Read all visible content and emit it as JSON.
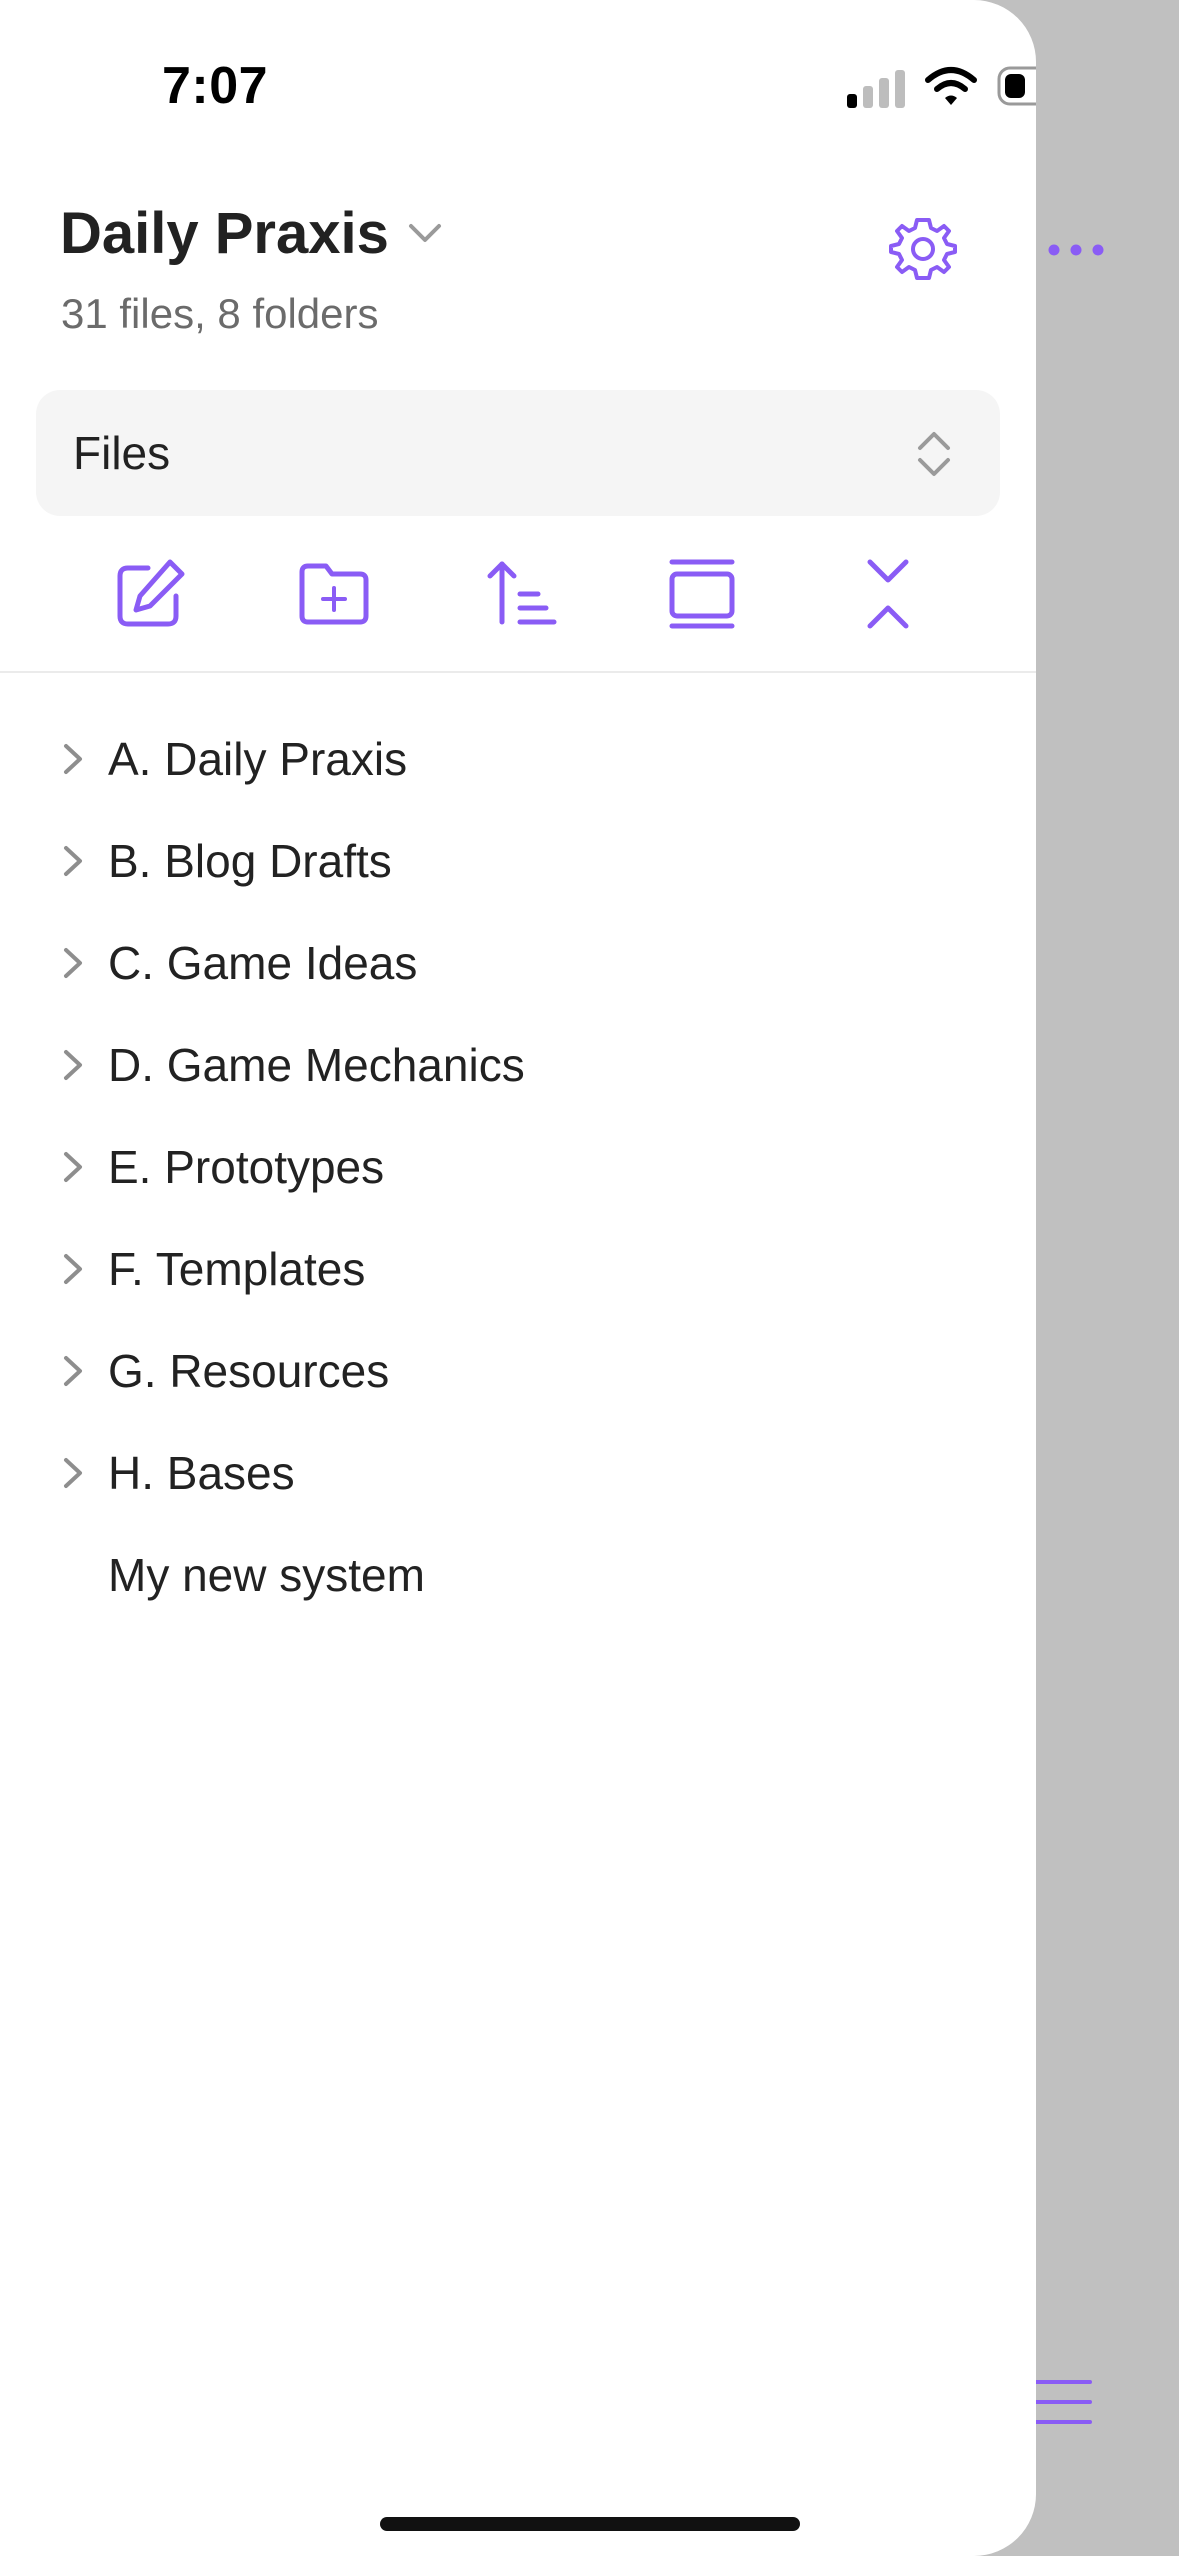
{
  "status_bar": {
    "time": "7:07"
  },
  "vault": {
    "name": "Daily Praxis",
    "stats": "31 files, 8 folders"
  },
  "view_selector": {
    "label": "Files"
  },
  "tree": {
    "folders": [
      {
        "label": "A. Daily Praxis"
      },
      {
        "label": "B. Blog Drafts"
      },
      {
        "label": "C. Game Ideas"
      },
      {
        "label": "D. Game Mechanics"
      },
      {
        "label": "E. Prototypes"
      },
      {
        "label": "F. Templates"
      },
      {
        "label": "G. Resources"
      },
      {
        "label": "H. Bases"
      }
    ],
    "files": [
      {
        "label": "My new system"
      }
    ]
  },
  "icons": {
    "toolbar": [
      "new-note-icon",
      "new-folder-icon",
      "sort-icon",
      "auto-reveal-icon",
      "collapse-all-icon"
    ],
    "header": [
      "chevron-down-icon",
      "gear-icon"
    ],
    "background": [
      "more-icon",
      "menu-icon"
    ]
  },
  "colors": {
    "accent": "#8a5cf5",
    "text": "#222222",
    "muted": "#6b6b6b",
    "drawer_bg": "#ffffff",
    "backdrop": "#c0c0c0"
  }
}
